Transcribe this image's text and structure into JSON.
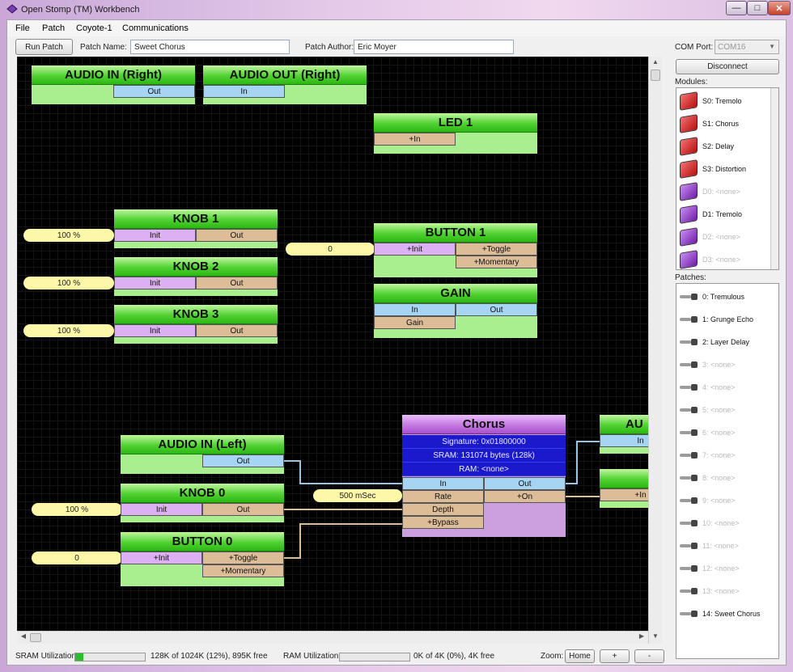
{
  "window": {
    "title": "Open Stomp (TM) Workbench"
  },
  "menu": [
    "File",
    "Patch",
    "Coyote-1",
    "Communications"
  ],
  "toolbar": {
    "run_patch": "Run Patch",
    "patch_name_label": "Patch Name:",
    "patch_name": "Sweet Chorus",
    "patch_author_label": "Patch Author:",
    "patch_author": "Eric Moyer"
  },
  "sidebar": {
    "com_port_label": "COM Port:",
    "com_port": "COM16",
    "disconnect": "Disconnect",
    "modules_label": "Modules:",
    "modules": [
      {
        "label": "S0: Tremolo",
        "color": "red"
      },
      {
        "label": "S1: Chorus",
        "color": "red"
      },
      {
        "label": "S2: Delay",
        "color": "red"
      },
      {
        "label": "S3: Distortion",
        "color": "red"
      },
      {
        "label": "D0: <none>",
        "color": "purple"
      },
      {
        "label": "D1: Tremolo",
        "color": "purple"
      },
      {
        "label": "D2: <none>",
        "color": "purple"
      },
      {
        "label": "D3: <none>",
        "color": "purple"
      }
    ],
    "patches_label": "Patches:",
    "patches": [
      "0: Tremulous",
      "1: Grunge Echo",
      "2: Layer Delay",
      "3: <none>",
      "4: <none>",
      "5: <none>",
      "6: <none>",
      "7: <none>",
      "8: <none>",
      "9: <none>",
      "10: <none>",
      "11: <none>",
      "12: <none>",
      "13: <none>",
      "14: Sweet Chorus"
    ]
  },
  "canvas": {
    "audio_in_right": {
      "title": "AUDIO IN (Right)",
      "out": "Out"
    },
    "audio_out_right": {
      "title": "AUDIO OUT (Right)",
      "in": "In"
    },
    "led1": {
      "title": "LED 1",
      "in": "+In"
    },
    "knob1": {
      "title": "KNOB 1",
      "init": "Init",
      "out": "Out",
      "value": "100 %"
    },
    "knob2": {
      "title": "KNOB 2",
      "init": "Init",
      "out": "Out",
      "value": "100 %"
    },
    "knob3": {
      "title": "KNOB 3",
      "init": "Init",
      "out": "Out",
      "value": "100 %"
    },
    "button1": {
      "title": "BUTTON 1",
      "init": "+Init",
      "toggle": "+Toggle",
      "momentary": "+Momentary",
      "value": "0"
    },
    "gain": {
      "title": "GAIN",
      "in": "In",
      "out": "Out",
      "gain": "Gain"
    },
    "audio_in_left": {
      "title": "AUDIO IN (Left)",
      "out": "Out"
    },
    "knob0": {
      "title": "KNOB 0",
      "init": "Init",
      "out": "Out",
      "value": "100 %"
    },
    "button0": {
      "title": "BUTTON 0",
      "init": "+Init",
      "toggle": "+Toggle",
      "momentary": "+Momentary",
      "value": "0"
    },
    "chorus": {
      "title": "Chorus",
      "signature": "Signature: 0x01800000",
      "sram": "SRAM: 131074 bytes (128k)",
      "ram": "RAM: <none>",
      "in": "In",
      "out": "Out",
      "rate": "Rate",
      "on": "+On",
      "depth": "Depth",
      "bypass": "+Bypass",
      "rate_value": "500 mSec"
    },
    "audio_out_left_partial": {
      "title": "AU",
      "in": "In"
    },
    "led_partial": {
      "in": "+In"
    }
  },
  "status": {
    "sram_label": "SRAM Utilization:",
    "sram_fraction": 0.12,
    "sram_text": "128K of 1024K (12%), 895K free",
    "ram_label": "RAM Utilization:",
    "ram_fraction": 0.0,
    "ram_text": "0K of 4K (0%), 4K free",
    "zoom_label": "Zoom:",
    "zoom_home": "Home",
    "zoom_in": "+",
    "zoom_out": "-"
  }
}
